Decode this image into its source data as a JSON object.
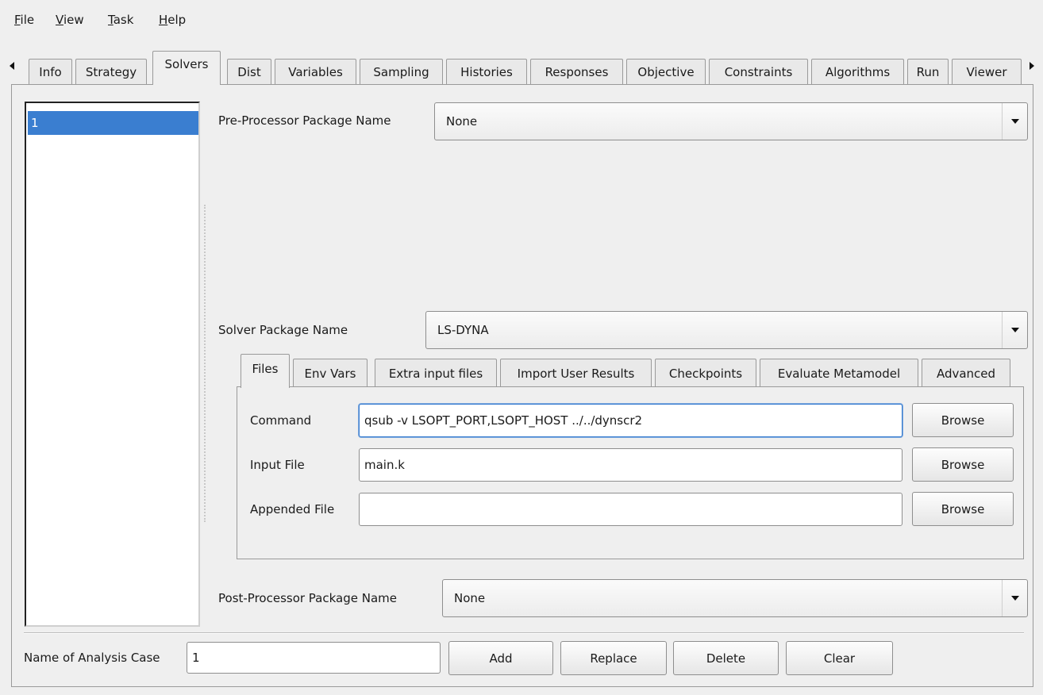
{
  "menubar": {
    "items": [
      {
        "accel": "F",
        "rest": "ile"
      },
      {
        "accel": "V",
        "rest": "iew"
      },
      {
        "accel": "T",
        "rest": "ask"
      },
      {
        "accel": "H",
        "rest": "elp"
      }
    ]
  },
  "main_tabs": [
    "Info",
    "Strategy",
    "Solvers",
    "Dist",
    "Variables",
    "Sampling",
    "Histories",
    "Responses",
    "Objective",
    "Constraints",
    "Algorithms",
    "Run",
    "Viewer"
  ],
  "active_main_tab": "Solvers",
  "case_list": {
    "items": [
      "1"
    ],
    "selected": "1"
  },
  "preprocessor": {
    "label": "Pre-Processor Package Name",
    "value": "None"
  },
  "solver": {
    "label": "Solver Package Name",
    "value": "LS-DYNA"
  },
  "solver_tabs": [
    "Files",
    "Env Vars",
    "Extra input files",
    "Import User Results",
    "Checkpoints",
    "Evaluate Metamodel",
    "Advanced"
  ],
  "active_solver_tab": "Files",
  "files": {
    "command_label": "Command",
    "command_value": "qsub -v LSOPT_PORT,LSOPT_HOST ../../dynscr2",
    "input_label": "Input File",
    "input_value": "main.k",
    "appended_label": "Appended File",
    "appended_value": "",
    "browse_label": "Browse"
  },
  "postprocessor": {
    "label": "Post-Processor Package Name",
    "value": "None"
  },
  "bottom": {
    "name_label": "Name of Analysis Case",
    "name_value": "1",
    "add_label": "Add",
    "replace_label": "Replace",
    "delete_label": "Delete",
    "clear_label": "Clear"
  },
  "colors": {
    "selection": "#3a7ed0",
    "background": "#efefef"
  }
}
